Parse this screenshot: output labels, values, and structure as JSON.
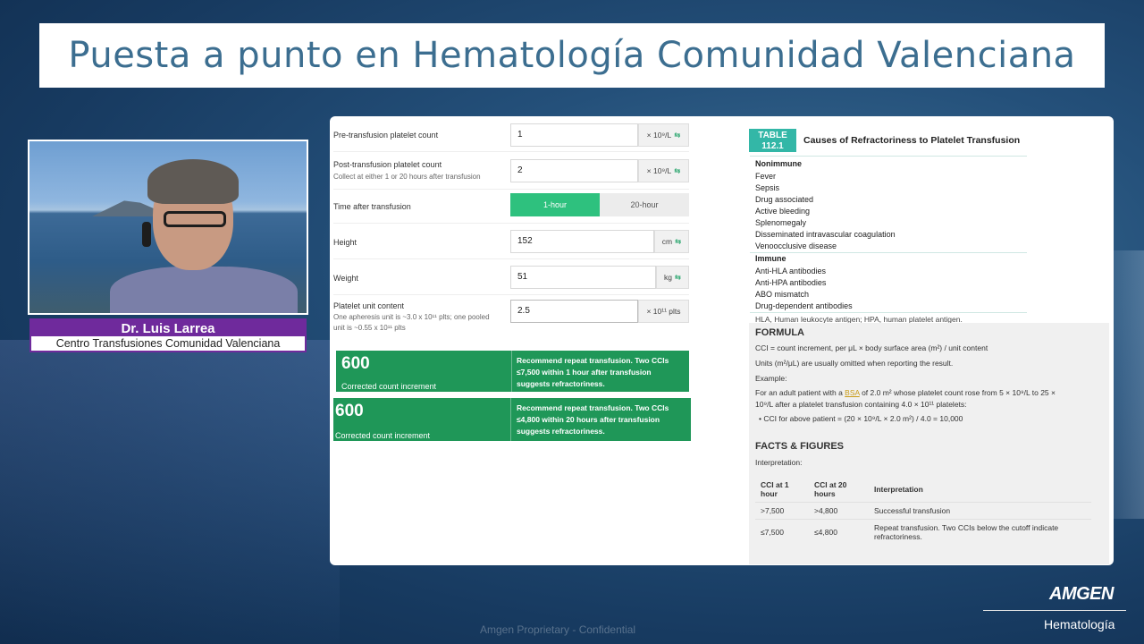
{
  "slide": {
    "title": "Puesta a punto en Hematología Comunidad Valenciana",
    "footer_confidential": "Amgen Proprietary - Confidential",
    "brand": "AMGEN",
    "brand_sub": "Hematología"
  },
  "presenter": {
    "name": "Dr. Luis Larrea",
    "organization": "Centro Transfusiones Comunidad Valenciana"
  },
  "calculator": {
    "pre_label": "Pre-transfusion platelet count",
    "pre_value": "1",
    "pre_unit": "× 10⁹/L",
    "post_label": "Post-transfusion platelet count",
    "post_sub": "Collect at either 1 or 20 hours after transfusion",
    "post_value": "2",
    "post_unit": "× 10⁹/L",
    "time_label": "Time after transfusion",
    "time_opt1": "1-hour",
    "time_opt2": "20-hour",
    "height_label": "Height",
    "height_value": "152",
    "height_unit": "cm",
    "weight_label": "Weight",
    "weight_value": "51",
    "weight_unit": "kg",
    "unit_label": "Platelet unit content",
    "unit_sub1": "One apheresis unit is ~3.0 x 10¹¹ plts; one pooled",
    "unit_sub2": "unit is ~0.55 x 10¹¹ plts",
    "unit_value": "2.5",
    "unit_unit": "× 10¹¹ plts",
    "swap_glyph": "⇆",
    "result1_value": "600",
    "result1_caption": "Corrected count increment",
    "result1_rec": "Recommend repeat transfusion. Two CCIs ≤7,500 within 1 hour after transfusion suggests refractoriness.",
    "result2_value": "600",
    "result2_caption": "Corrected count increment",
    "result2_rec": "Recommend repeat transfusion. Two CCIs ≤4,800 within 20 hours after transfusion suggests refractoriness."
  },
  "table": {
    "badge1": "TABLE",
    "badge2": "112.1",
    "title": "Causes of Refractoriness to Platelet Transfusion",
    "section1": "Nonimmune",
    "nonimmune": [
      "Fever",
      "Sepsis",
      "Drug associated",
      "Active bleeding",
      "Splenomegaly",
      "Disseminated intravascular coagulation",
      "Venoocclusive disease"
    ],
    "section2": "Immune",
    "immune": [
      "Anti-HLA antibodies",
      "Anti-HPA antibodies",
      "ABO mismatch",
      "Drug-dependent antibodies"
    ],
    "footnote": "HLA, Human leukocyte antigen; HPA, human platelet antigen."
  },
  "formula": {
    "heading": "FORMULA",
    "line1": "CCI = count increment, per μL × body surface area (m²) / unit content",
    "line2": "Units (m²/μL) are usually omitted when reporting the result.",
    "line3": "Example:",
    "line4a": "For an adult patient with a ",
    "line4_link": "BSA",
    "line4b": " of 2.0 m² whose platelet count rose from 5 × 10⁹/L to 25 ×",
    "line5": "10⁹/L after a platelet transfusion containing 4.0 × 10¹¹ platelets:",
    "line6": "• CCI for above patient = (20 × 10⁹/L × 2.0 m²) / 4.0 = 10,000",
    "facts_heading": "FACTS & FIGURES",
    "interpretation": "Interpretation:",
    "col1": "CCI at 1 hour",
    "col2": "CCI at 20 hours",
    "col3": "Interpretation",
    "rows": [
      {
        "c1": ">7,500",
        "c2": ">4,800",
        "c3": "Successful transfusion"
      },
      {
        "c1": "≤7,500",
        "c2": "≤4,800",
        "c3": "Repeat transfusion. Two CCIs below the cutoff indicate refractoriness."
      }
    ]
  }
}
